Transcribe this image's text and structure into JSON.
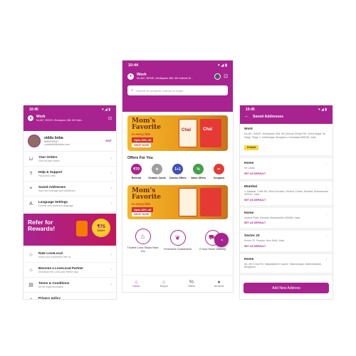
{
  "phone1": {
    "status": {
      "time": "10:45"
    },
    "header": {
      "title": "Work",
      "address": "No.667, BHIVE, Workspace 468, 5th Main..."
    },
    "profile": {
      "name": "siddu boba",
      "phone": "8660490531",
      "email": "s.siddu84@icloud.com",
      "edit": "EDIT"
    },
    "menu": [
      {
        "icon": "bag-icon",
        "title": "Your Orders",
        "sub": "View all past orders"
      },
      {
        "icon": "help-icon",
        "title": "Help & Support",
        "sub": "FAQs and Links"
      },
      {
        "icon": "location-icon",
        "title": "Saved Addresses",
        "sub": "Save and manage your addresses"
      },
      {
        "icon": "language-icon",
        "title": "Language Settings",
        "sub": "Choose your preferred language"
      }
    ],
    "refer": {
      "title": "Refer for",
      "title2": "Rewards!",
      "badge": "₹75",
      "badge2": "EACH"
    },
    "menu2": [
      {
        "icon": "star-icon",
        "title": "Rate LoveLocal",
        "sub": "Share your experience with us"
      },
      {
        "icon": "store-icon",
        "title": "Become a LoveLocal Partner",
        "sub": "Download the LoveLocal Partner app"
      },
      {
        "icon": "document-icon",
        "title": "Terms & Conditions",
        "sub": "All the legal information"
      },
      {
        "icon": "shield-icon",
        "title": "Privacy policy",
        "sub": "About our policy"
      }
    ]
  },
  "phone2": {
    "status": {
      "time": "10:44"
    },
    "header": {
      "title": "Work",
      "address": "No.667, BHIVE, Workspace 468, 5th Krishna Te..."
    },
    "search": {
      "placeholder": "Search for products, brands or shops"
    },
    "banner": {
      "line1": "Mom's",
      "line2": "Favorite",
      "line3": "in every bite",
      "offer": "Upto 40% off",
      "cta": "SHOP NOW",
      "pack1": "Chai",
      "pack2": "Chai"
    },
    "offers_title": "Offers For You",
    "offers": [
      {
        "label": "Referral",
        "badge": "₹70",
        "color": "#a8238f"
      },
      {
        "label": "Scratch Cards",
        "badge": "★",
        "color": "#9e9e9e"
      },
      {
        "label": "Combo Offers",
        "badge": "1+1",
        "color": "#3f51b5"
      },
      {
        "label": "Value Offers",
        "badge": "%",
        "color": "#43a047"
      },
      {
        "label": "Coupons",
        "badge": "✂",
        "color": "#e53935"
      }
    ],
    "features": [
      {
        "icon": "shop-icon",
        "text": "Trusted Local Shops Near You"
      },
      {
        "icon": "leaf-icon",
        "text": "Freshness Guaranteed"
      },
      {
        "icon": "delivery-icon",
        "text": "2 Hour Home Delivery"
      }
    ],
    "tabs": [
      {
        "icon": "home-icon",
        "label": "Home"
      },
      {
        "icon": "shop-icon",
        "label": "Shops"
      },
      {
        "icon": "offers-icon",
        "label": "Offers"
      },
      {
        "icon": "account-icon",
        "label": "Account"
      }
    ]
  },
  "phone3": {
    "status": {
      "time": "10:45"
    },
    "title": "Saved Addresses",
    "addresses": [
      {
        "name": "Work",
        "address": "No.667, BHIVE, Workspace 468, 5th Krishna Temple Rd, Indira Nagar 1st Stage, Stage 1, Indiranagar, Bengaluru, Karnataka 560038, India",
        "action": "Default"
      },
      {
        "name": "Home",
        "address": "Sri Lanka",
        "action": "SET AS DEFAULT"
      },
      {
        "name": "Mumbai",
        "address": "4, Malabar, Cuffe Rd, Shirin Enclave, Ferdhoi Chowk, Mumbai, Maharashtra 400021, India",
        "action": "SET AS DEFAULT"
      },
      {
        "name": "Home",
        "address": "Andheri East, Mumbai, Maharashtra 400069, India",
        "action": "SET AS DEFAULT"
      },
      {
        "name": "Sector 23",
        "address": "Sector 23, Dwarka, New Delhi, India",
        "action": "SET AS DEFAULT"
      },
      {
        "name": "Home",
        "address": "4A, 4th Cross Rd, Vijayalakshmi Layout, Yadavanagar, Malleshwaram, Bengaluru",
        "action": ""
      }
    ],
    "add_button": "Add New Address"
  },
  "colors": {
    "brand": "#a8238f",
    "accent": "#e89a1c"
  }
}
